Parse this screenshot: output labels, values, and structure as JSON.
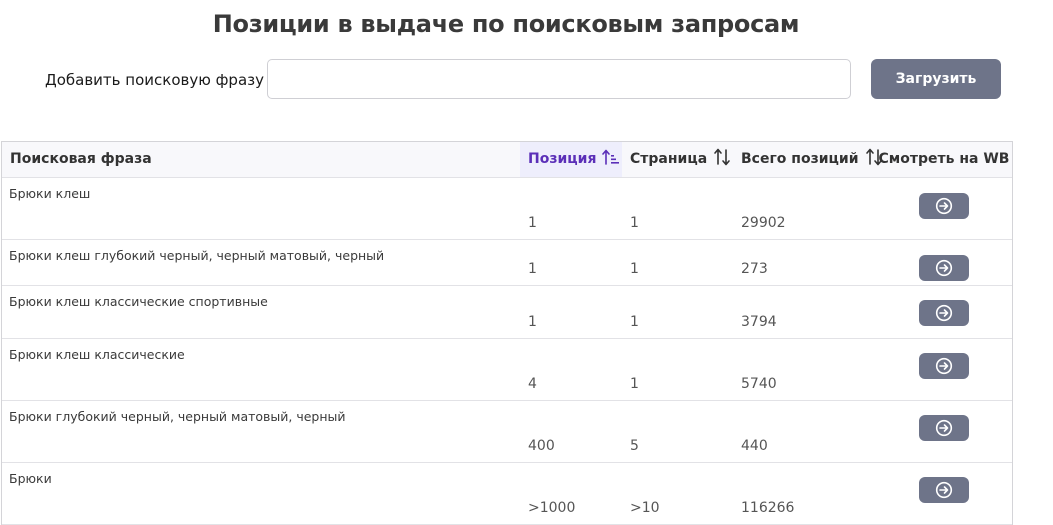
{
  "page": {
    "title": "Позиции в выдаче по поисковым запросам"
  },
  "search": {
    "label": "Добавить поисковую фразу",
    "value": "",
    "placeholder": "",
    "button_label": "Загрузить"
  },
  "table": {
    "columns": [
      {
        "label": "Поисковая фраза",
        "sortable": false
      },
      {
        "label": "Позиция",
        "sortable": true,
        "sorted": "ascending"
      },
      {
        "label": "Страница",
        "sortable": true
      },
      {
        "label": "Всего позиций",
        "sortable": true
      },
      {
        "label": "Смотреть на WB",
        "sortable": false
      }
    ],
    "rows": [
      {
        "phrase": "Брюки клеш",
        "position": "1",
        "page": "1",
        "total": "29902"
      },
      {
        "phrase": "Брюки клеш глубокий черный, черный матовый, черный",
        "position": "1",
        "page": "1",
        "total": "273"
      },
      {
        "phrase": "Брюки клеш классические спортивные",
        "position": "1",
        "page": "1",
        "total": "3794"
      },
      {
        "phrase": "Брюки клеш классические",
        "position": "4",
        "page": "1",
        "total": "5740"
      },
      {
        "phrase": "Брюки глубокий черный, черный матовый, черный",
        "position": "400",
        "page": "5",
        "total": "440"
      },
      {
        "phrase": "Брюки",
        "position": ">1000",
        "page": ">10",
        "total": "116266"
      }
    ]
  },
  "icons": {
    "sort_active": "sort-ascending-icon",
    "sort_inactive": "sort-arrows-icon",
    "open": "arrow-right-circle-icon"
  },
  "colors": {
    "button": "#6e7489",
    "sorted_header_bg": "#eeeefc",
    "sorted_header_text": "#5b2fb8"
  }
}
